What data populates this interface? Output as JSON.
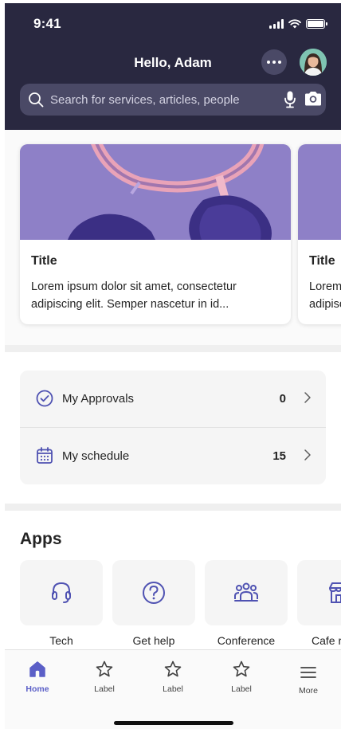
{
  "status_bar": {
    "time": "9:41"
  },
  "header": {
    "greeting": "Hello, Adam",
    "search_placeholder": "Search for services, articles, people",
    "icons": [
      "more-icon",
      "avatar",
      "search-icon",
      "mic-icon",
      "camera-icon"
    ]
  },
  "cards": [
    {
      "title": "Title",
      "body": "Lorem ipsum dolor sit amet, consectetur adipiscing elit. Semper nascetur in id..."
    },
    {
      "title": "Title",
      "body": "Lorem ipsum dolor sit amet, consectetur adipiscing elit. Semper nascetur in id..."
    }
  ],
  "list": [
    {
      "label": "My Approvals",
      "count": "0",
      "icon": "check-circle-icon"
    },
    {
      "label": "My schedule",
      "count": "15",
      "icon": "calendar-icon"
    }
  ],
  "apps": {
    "title": "Apps",
    "items": [
      {
        "label": "Tech",
        "icon": "headset-icon"
      },
      {
        "label": "Get help",
        "icon": "question-icon"
      },
      {
        "label": "Conference",
        "icon": "people-icon"
      },
      {
        "label": "Cafe r",
        "icon": "store-icon"
      }
    ]
  },
  "tabbar": {
    "tabs": [
      {
        "label": "Home",
        "icon": "home-icon",
        "active": true
      },
      {
        "label": "Label",
        "icon": "star-icon"
      },
      {
        "label": "Label",
        "icon": "star-icon"
      },
      {
        "label": "Label",
        "icon": "star-icon"
      },
      {
        "label": "More",
        "icon": "menu-icon"
      }
    ]
  },
  "colors": {
    "header_bg": "#292840",
    "accent": "#5b5fc7",
    "card_image": "#8e80c7"
  }
}
